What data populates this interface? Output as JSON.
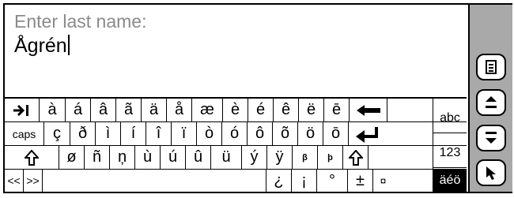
{
  "prompt": "Enter last name:",
  "value": "Ågrén",
  "keyboard": {
    "row1": [
      "à",
      "á",
      "â",
      "ã",
      "ä",
      "å",
      "æ",
      "è",
      "é",
      "ê",
      "ë",
      "ē"
    ],
    "row2": [
      "ç",
      "ð",
      "ì",
      "í",
      "î",
      "ï",
      "ò",
      "ó",
      "ô",
      "õ",
      "ö",
      "ō"
    ],
    "row3": [
      "ø",
      "ñ",
      "ņ",
      "ù",
      "ú",
      "û",
      "ü",
      "ý",
      "ÿ",
      "β",
      "þ"
    ],
    "row4": [
      "¿",
      "¡",
      "°",
      "±",
      "¤"
    ],
    "caps_label": "caps",
    "scroll_left_label": "<<",
    "scroll_right_label": ">>"
  },
  "modes": {
    "abc": "abc",
    "num": "123",
    "accent": "äéö"
  },
  "sidebar": {
    "icons": [
      "menu-icon",
      "scroll-up-icon",
      "scroll-down-icon",
      "pointer-icon"
    ]
  }
}
